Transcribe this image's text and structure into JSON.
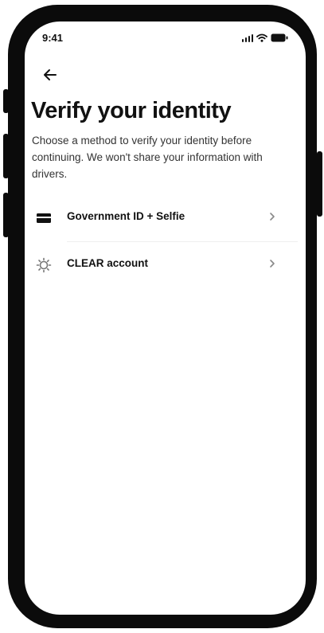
{
  "status_bar": {
    "time": "9:41"
  },
  "header": {
    "back_icon": "arrow-left-icon",
    "title": "Verify your identity",
    "description": "Choose a method to verify your identity before continuing. We won't share your information with drivers."
  },
  "options": [
    {
      "label": "Government ID + Selfie",
      "icon": "id-card-icon"
    },
    {
      "label": "CLEAR account",
      "icon": "clear-logo-icon"
    }
  ]
}
